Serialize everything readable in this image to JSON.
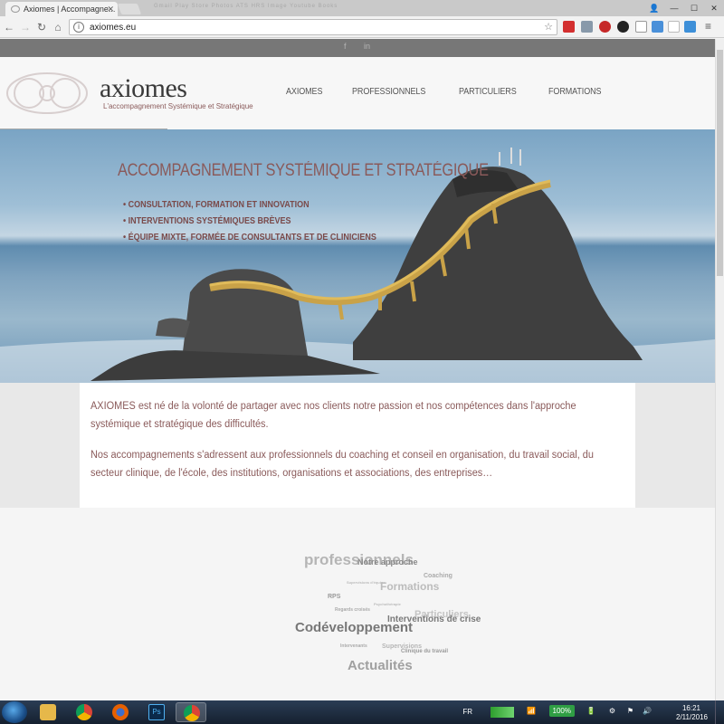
{
  "browser": {
    "tab_title": "Axiomes | Accompagne...",
    "url": "axiomes.eu",
    "ghost_tabs": "Gmail   Play Store   Photos   ATS   HRS Image   Youtube   Books"
  },
  "site": {
    "logo_name": "axiomes",
    "logo_tagline": "L'accompagnement Systémique et Stratégique",
    "social": [
      "f",
      "in"
    ],
    "nav": [
      "AXIOMES",
      "PROFESSIONNELS",
      "PARTICULIERS",
      "FORMATIONS"
    ],
    "hero_title": "ACCOMPAGNEMENT SYSTÉMIQUE ET STRATÉGIQUE",
    "hero_points": [
      "CONSULTATION, FORMATION ET INNOVATION",
      "INTERVENTIONS SYSTÉMIQUES BRÈVES",
      "ÉQUIPE MIXTE, FORMÉE DE CONSULTANTS ET DE CLINICIENS"
    ],
    "intro_p1": "AXIOMES est né de la volonté de partager avec nos clients notre passion et nos compétences dans l'approche systémique et stratégique des difficultés.",
    "intro_p2": "Nos accompagnements s'adressent aux professionnels du coaching et conseil en organisation, du travail social, du secteur clinique, de l'école, des institutions, organisations et associations, des entreprises…",
    "cloud": [
      {
        "word": "professionnels",
        "size": 17,
        "color": "#b5b5b5"
      },
      {
        "word": "Notre approche",
        "size": 9,
        "color": "#8a8a8a"
      },
      {
        "word": "Coaching",
        "size": 7,
        "color": "#aaaaaa"
      },
      {
        "word": "Supervisions d'équipe",
        "size": 4,
        "color": "#bbbbbb"
      },
      {
        "word": "Formations",
        "size": 12,
        "color": "#bcbcbc"
      },
      {
        "word": "RPS",
        "size": 7,
        "color": "#999999"
      },
      {
        "word": "Psychothérapie",
        "size": 4,
        "color": "#bbbbbb"
      },
      {
        "word": "Regards croisés",
        "size": 5,
        "color": "#aaaaaa"
      },
      {
        "word": "Particuliers",
        "size": 11,
        "color": "#c4c4c4"
      },
      {
        "word": "Interventions de crise",
        "size": 10,
        "color": "#7a7a7a"
      },
      {
        "word": "Codéveloppement",
        "size": 15,
        "color": "#777777"
      },
      {
        "word": "Intervenants",
        "size": 5,
        "color": "#aaaaaa"
      },
      {
        "word": "Supervisions",
        "size": 7,
        "color": "#b5b5b5"
      },
      {
        "word": "Clinique du travail",
        "size": 6,
        "color": "#999999"
      },
      {
        "word": "Actualités",
        "size": 15,
        "color": "#a0a0a0"
      }
    ]
  },
  "taskbar": {
    "lang": "FR",
    "battery": "100%",
    "time": "16:21",
    "date": "2/11/2016"
  },
  "colors": {
    "accent": "#8a5a5a",
    "social_bar": "#777777",
    "taskbar": "#1d2a3c"
  }
}
